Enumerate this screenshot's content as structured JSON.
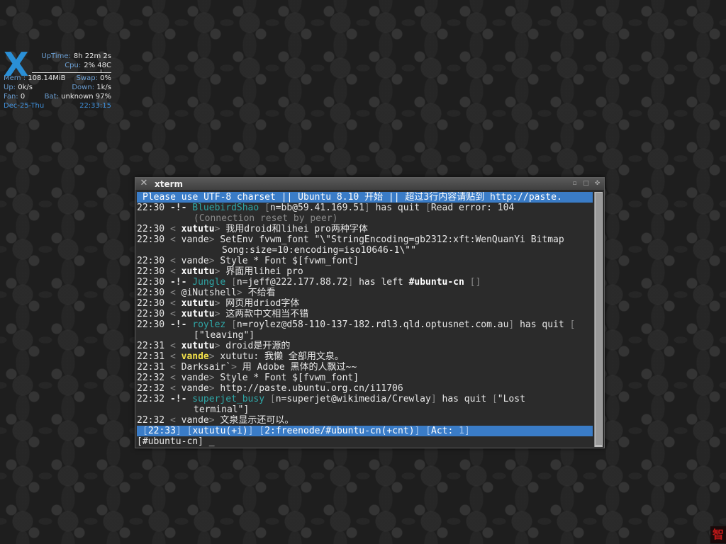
{
  "desktop": {
    "sysmon": {
      "logo_letter": "X",
      "uptime_label": "UpTime:",
      "uptime_value": "8h 22m 2s",
      "cpu_label": "Cpu:",
      "cpu_value": "2% 48C",
      "mem_label": "Mem :",
      "mem_value": "108.14MiB",
      "swap_label": "Swap:",
      "swap_value": "0%",
      "up_label": "Up:",
      "up_value": "0k/s",
      "down_label": "Down:",
      "down_value": "1k/s",
      "fan_label": "Fan:",
      "fan_value": "0",
      "bat_label": "Bat:",
      "bat_value": "unknown 97%",
      "date": "Dec-25-Thu",
      "time": "22:33:15"
    },
    "corner_logo": "智"
  },
  "xterm": {
    "title": "xterm",
    "topic": "Please use UTF-8 charset || Ubuntu 8.10 开始 || 超过3行内容请贴到 http://paste.",
    "lines": [
      {
        "ts": "22:30",
        "kind": "quit",
        "nick": "BluebirdShao",
        "host": "n=bb@59.41.169.51",
        "action": "has quit",
        "reason": "Read error: 104"
      },
      {
        "kind": "cont",
        "text": "(Connection reset by peer)",
        "dim": true
      },
      {
        "ts": "22:30",
        "kind": "msg",
        "nick": "xututu",
        "nick_style": "bold",
        "text": "我用droid和lihei pro两种字体"
      },
      {
        "ts": "22:30",
        "kind": "msg",
        "nick": "vande",
        "nick_style": "plain",
        "text": "SetEnv fvwm_font \"\\\"StringEncoding=gb2312:xft:WenQuanYi Bitmap"
      },
      {
        "kind": "cont2",
        "text": "Song:size=10:encoding=iso10646-1\\\"\""
      },
      {
        "ts": "22:30",
        "kind": "msg",
        "nick": "vande",
        "nick_style": "plain",
        "text": "Style * Font $[fvwm_font]"
      },
      {
        "ts": "22:30",
        "kind": "msg",
        "nick": "xututu",
        "nick_style": "bold",
        "text": "界面用lihei pro"
      },
      {
        "ts": "22:30",
        "kind": "left",
        "nick": "Jungle",
        "host": "n=jeff@222.177.88.72",
        "action": "has left",
        "channel": "#ubuntu-cn",
        "reason": ""
      },
      {
        "ts": "22:30",
        "kind": "msg",
        "nick": "@iNutshell",
        "nick_style": "plain",
        "text": "不给看"
      },
      {
        "ts": "22:30",
        "kind": "msg",
        "nick": "xututu",
        "nick_style": "bold",
        "text": "网页用driod字体"
      },
      {
        "ts": "22:30",
        "kind": "msg",
        "nick": "xututu",
        "nick_style": "bold",
        "text": "这两款中文相当不错"
      },
      {
        "ts": "22:30",
        "kind": "quit",
        "nick": "roylez",
        "host": "n=roylez@d58-110-137-182.rdl3.qld.optusnet.com.au",
        "action": "has quit",
        "reason": ""
      },
      {
        "kind": "cont",
        "text": "[\"leaving\"]",
        "dim": false
      },
      {
        "ts": "22:31",
        "kind": "msg",
        "nick": "xututu",
        "nick_style": "bold",
        "text": "droid是开源的"
      },
      {
        "ts": "22:31",
        "kind": "msg",
        "nick": "vande",
        "nick_style": "yellow",
        "text": "xututu: 我懒 全部用文泉。"
      },
      {
        "ts": "22:31",
        "kind": "msg",
        "nick": "Darksair`",
        "nick_style": "plain",
        "text": "用 Adobe 黑体的人飘过~~"
      },
      {
        "ts": "22:32",
        "kind": "msg",
        "nick": "vande",
        "nick_style": "plain",
        "text": "Style * Font $[fvwm_font]"
      },
      {
        "ts": "22:32",
        "kind": "msg",
        "nick": "vande",
        "nick_style": "plain",
        "text": "http://paste.ubuntu.org.cn/i11706"
      },
      {
        "ts": "22:32",
        "kind": "quit",
        "nick": "superjet_busy",
        "host": "n=superjet@wikimedia/Crewlay",
        "action": "has quit",
        "reason": "\"Lost"
      },
      {
        "kind": "cont",
        "text": "terminal\"]",
        "dim": false
      },
      {
        "ts": "22:32",
        "kind": "msg",
        "nick": "vande",
        "nick_style": "plain",
        "text": "文泉显示还可以。"
      }
    ],
    "status": {
      "time": "22:33",
      "user": "xututu(+i)",
      "window": "2:freenode/#ubuntu-cn(+cnt)",
      "act": "Act:"
    },
    "prompt": "[#ubuntu-cn] _"
  },
  "colors": {
    "accent_blue": "#3a7cc7",
    "join_cyan": "#2fa6a6",
    "highlight_yellow": "#f2e04a"
  }
}
